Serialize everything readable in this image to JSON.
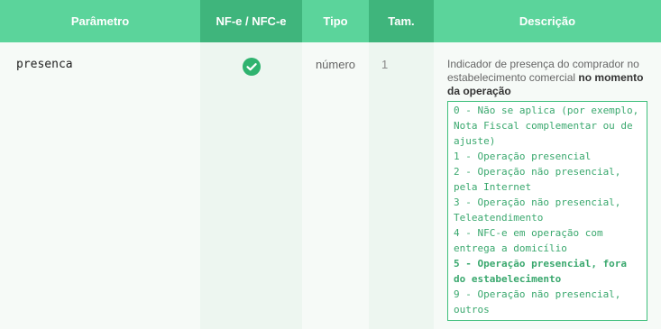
{
  "table": {
    "headers": [
      {
        "label": "Parâmetro"
      },
      {
        "label": "NF-e / NFC-e"
      },
      {
        "label": "Tipo"
      },
      {
        "label": "Tam."
      },
      {
        "label": "Descrição"
      }
    ],
    "row": {
      "parametro": "presenca",
      "nf_icon": "check-circle-icon",
      "tipo": "número",
      "tam": "1",
      "descricao_prefix": "Indicador de presença do comprador no estabelecimento comercial ",
      "descricao_bold": "no momento da operação",
      "options": [
        {
          "text": "0 - Não se aplica (por exemplo, Nota Fiscal complementar ou de ajuste)",
          "bold": false
        },
        {
          "text": "1 - Operação presencial",
          "bold": false
        },
        {
          "text": "2 - Operação não presencial, pela Internet",
          "bold": false
        },
        {
          "text": "3 - Operação não presencial, Teleatendimento",
          "bold": false
        },
        {
          "text": "4 - NFC-e em operação com entrega a domicílio",
          "bold": false
        },
        {
          "text": "5 - Operação presencial, fora do estabelecimento",
          "bold": true
        },
        {
          "text": "9 - Operação não presencial, outros",
          "bold": false
        }
      ]
    }
  },
  "colors": {
    "header": "#5bd49b",
    "header_dark": "#3fb57c",
    "check": "#2fb36f",
    "code_text": "#3aa86e"
  }
}
